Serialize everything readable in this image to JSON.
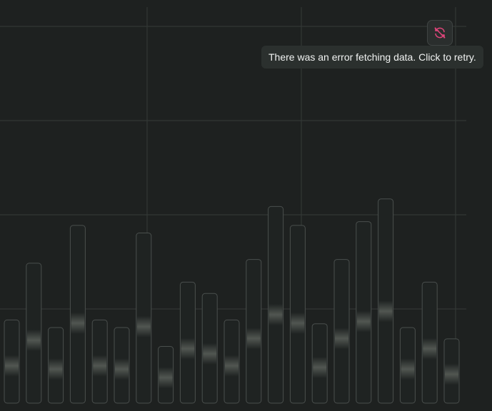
{
  "chart_data": {
    "type": "bar",
    "state": "loading-skeleton",
    "values": [
      0.22,
      0.37,
      0.2,
      0.47,
      0.22,
      0.2,
      0.45,
      0.15,
      0.32,
      0.29,
      0.22,
      0.38,
      0.52,
      0.47,
      0.21,
      0.38,
      0.48,
      0.54,
      0.2,
      0.32,
      0.17
    ],
    "grid": true
  },
  "error": {
    "icon": "sync-off-icon",
    "icon_color": "#e0457b",
    "tooltip_text": "There was an error fetching data. Click to retry."
  }
}
